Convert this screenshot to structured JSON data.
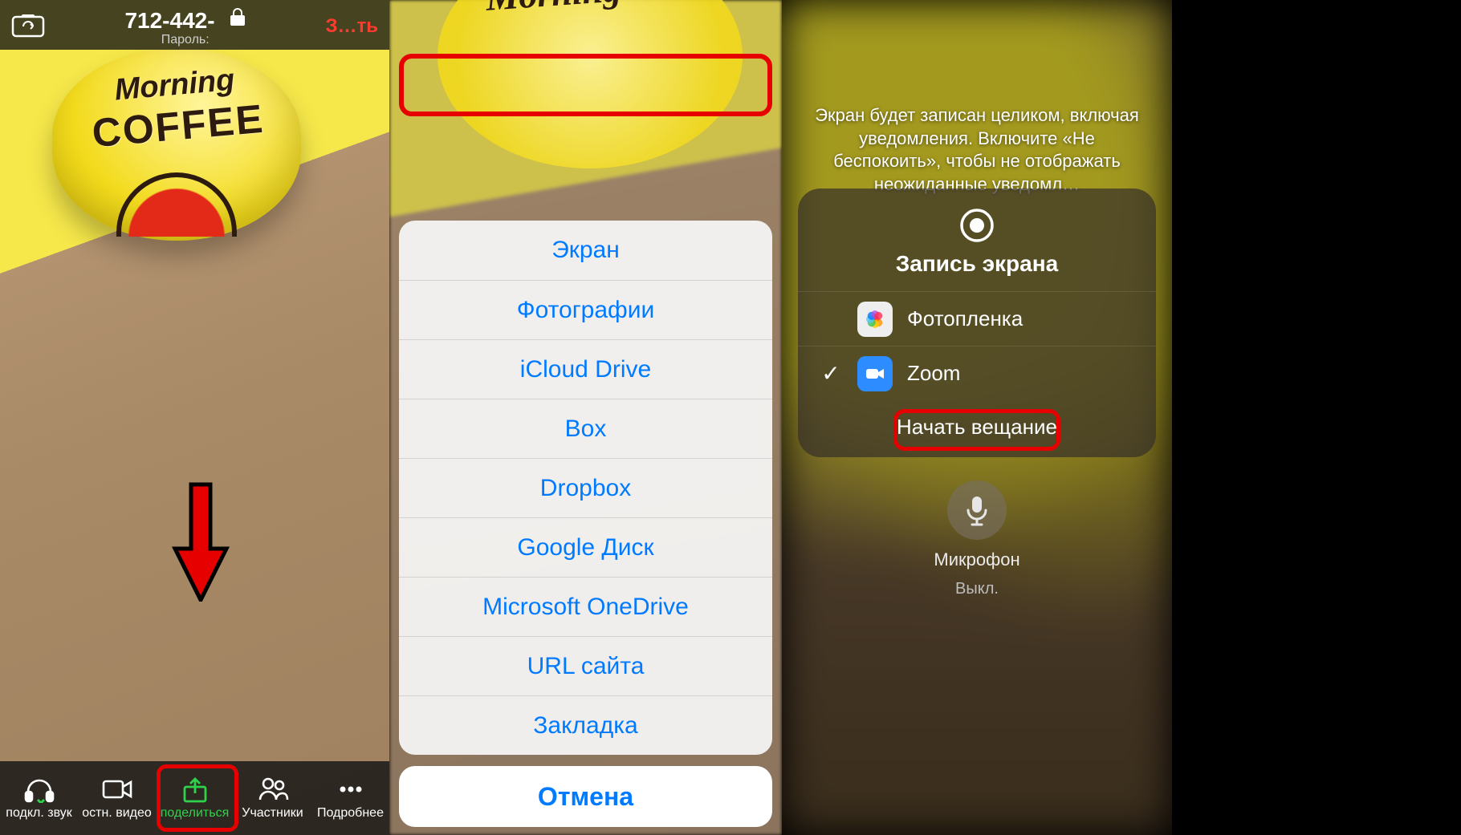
{
  "panel1": {
    "mug_line1": "Morning",
    "mug_line2": "COFFEE",
    "meeting_id": "712-442-",
    "password_label": "Пароль:",
    "leave_label": "З…ть",
    "toolbar": [
      {
        "name": "audio",
        "label": "подкл. звук"
      },
      {
        "name": "video",
        "label": "остн. видео"
      },
      {
        "name": "share",
        "label": "поделиться"
      },
      {
        "name": "participants",
        "label": "Участники"
      },
      {
        "name": "more",
        "label": "Подробнее"
      }
    ]
  },
  "panel2": {
    "options": [
      "Экран",
      "Фотографии",
      "iCloud Drive",
      "Box",
      "Dropbox",
      "Google Диск",
      "Microsoft OneDrive",
      "URL сайта",
      "Закладка"
    ],
    "cancel": "Отмена"
  },
  "panel3": {
    "info": "Экран будет записан целиком, включая уведомления. Включите «Не беспокоить», чтобы не отображать неожиданные уведомл…",
    "card_title": "Запись экрана",
    "rows": [
      {
        "name": "photos",
        "label": "Фотопленка",
        "selected": false
      },
      {
        "name": "zoom",
        "label": "Zoom",
        "selected": true
      }
    ],
    "start": "Начать вещание",
    "mic_label": "Микрофон",
    "mic_state": "Выкл."
  }
}
